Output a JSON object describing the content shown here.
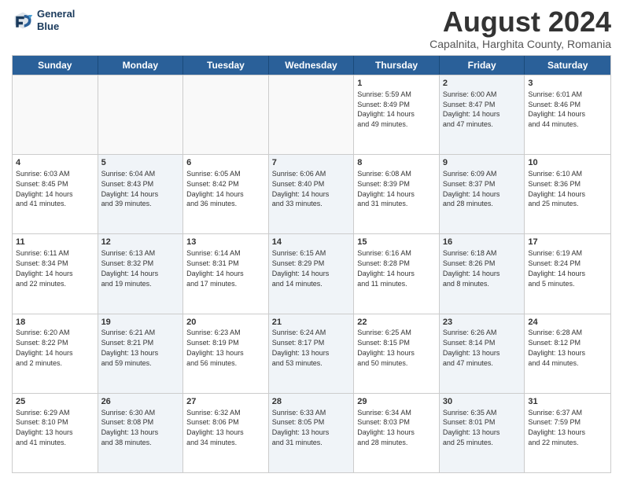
{
  "header": {
    "logo_line1": "General",
    "logo_line2": "Blue",
    "title": "August 2024",
    "subtitle": "Capalnita, Harghita County, Romania"
  },
  "days": [
    "Sunday",
    "Monday",
    "Tuesday",
    "Wednesday",
    "Thursday",
    "Friday",
    "Saturday"
  ],
  "rows": [
    [
      {
        "day": "",
        "text": "",
        "empty": true
      },
      {
        "day": "",
        "text": "",
        "empty": true
      },
      {
        "day": "",
        "text": "",
        "empty": true
      },
      {
        "day": "",
        "text": "",
        "empty": true
      },
      {
        "day": "1",
        "text": "Sunrise: 5:59 AM\nSunset: 8:49 PM\nDaylight: 14 hours\nand 49 minutes.",
        "shaded": false
      },
      {
        "day": "2",
        "text": "Sunrise: 6:00 AM\nSunset: 8:47 PM\nDaylight: 14 hours\nand 47 minutes.",
        "shaded": true
      },
      {
        "day": "3",
        "text": "Sunrise: 6:01 AM\nSunset: 8:46 PM\nDaylight: 14 hours\nand 44 minutes.",
        "shaded": false
      }
    ],
    [
      {
        "day": "4",
        "text": "Sunrise: 6:03 AM\nSunset: 8:45 PM\nDaylight: 14 hours\nand 41 minutes.",
        "shaded": false
      },
      {
        "day": "5",
        "text": "Sunrise: 6:04 AM\nSunset: 8:43 PM\nDaylight: 14 hours\nand 39 minutes.",
        "shaded": true
      },
      {
        "day": "6",
        "text": "Sunrise: 6:05 AM\nSunset: 8:42 PM\nDaylight: 14 hours\nand 36 minutes.",
        "shaded": false
      },
      {
        "day": "7",
        "text": "Sunrise: 6:06 AM\nSunset: 8:40 PM\nDaylight: 14 hours\nand 33 minutes.",
        "shaded": true
      },
      {
        "day": "8",
        "text": "Sunrise: 6:08 AM\nSunset: 8:39 PM\nDaylight: 14 hours\nand 31 minutes.",
        "shaded": false
      },
      {
        "day": "9",
        "text": "Sunrise: 6:09 AM\nSunset: 8:37 PM\nDaylight: 14 hours\nand 28 minutes.",
        "shaded": true
      },
      {
        "day": "10",
        "text": "Sunrise: 6:10 AM\nSunset: 8:36 PM\nDaylight: 14 hours\nand 25 minutes.",
        "shaded": false
      }
    ],
    [
      {
        "day": "11",
        "text": "Sunrise: 6:11 AM\nSunset: 8:34 PM\nDaylight: 14 hours\nand 22 minutes.",
        "shaded": false
      },
      {
        "day": "12",
        "text": "Sunrise: 6:13 AM\nSunset: 8:32 PM\nDaylight: 14 hours\nand 19 minutes.",
        "shaded": true
      },
      {
        "day": "13",
        "text": "Sunrise: 6:14 AM\nSunset: 8:31 PM\nDaylight: 14 hours\nand 17 minutes.",
        "shaded": false
      },
      {
        "day": "14",
        "text": "Sunrise: 6:15 AM\nSunset: 8:29 PM\nDaylight: 14 hours\nand 14 minutes.",
        "shaded": true
      },
      {
        "day": "15",
        "text": "Sunrise: 6:16 AM\nSunset: 8:28 PM\nDaylight: 14 hours\nand 11 minutes.",
        "shaded": false
      },
      {
        "day": "16",
        "text": "Sunrise: 6:18 AM\nSunset: 8:26 PM\nDaylight: 14 hours\nand 8 minutes.",
        "shaded": true
      },
      {
        "day": "17",
        "text": "Sunrise: 6:19 AM\nSunset: 8:24 PM\nDaylight: 14 hours\nand 5 minutes.",
        "shaded": false
      }
    ],
    [
      {
        "day": "18",
        "text": "Sunrise: 6:20 AM\nSunset: 8:22 PM\nDaylight: 14 hours\nand 2 minutes.",
        "shaded": false
      },
      {
        "day": "19",
        "text": "Sunrise: 6:21 AM\nSunset: 8:21 PM\nDaylight: 13 hours\nand 59 minutes.",
        "shaded": true
      },
      {
        "day": "20",
        "text": "Sunrise: 6:23 AM\nSunset: 8:19 PM\nDaylight: 13 hours\nand 56 minutes.",
        "shaded": false
      },
      {
        "day": "21",
        "text": "Sunrise: 6:24 AM\nSunset: 8:17 PM\nDaylight: 13 hours\nand 53 minutes.",
        "shaded": true
      },
      {
        "day": "22",
        "text": "Sunrise: 6:25 AM\nSunset: 8:15 PM\nDaylight: 13 hours\nand 50 minutes.",
        "shaded": false
      },
      {
        "day": "23",
        "text": "Sunrise: 6:26 AM\nSunset: 8:14 PM\nDaylight: 13 hours\nand 47 minutes.",
        "shaded": true
      },
      {
        "day": "24",
        "text": "Sunrise: 6:28 AM\nSunset: 8:12 PM\nDaylight: 13 hours\nand 44 minutes.",
        "shaded": false
      }
    ],
    [
      {
        "day": "25",
        "text": "Sunrise: 6:29 AM\nSunset: 8:10 PM\nDaylight: 13 hours\nand 41 minutes.",
        "shaded": false
      },
      {
        "day": "26",
        "text": "Sunrise: 6:30 AM\nSunset: 8:08 PM\nDaylight: 13 hours\nand 38 minutes.",
        "shaded": true
      },
      {
        "day": "27",
        "text": "Sunrise: 6:32 AM\nSunset: 8:06 PM\nDaylight: 13 hours\nand 34 minutes.",
        "shaded": false
      },
      {
        "day": "28",
        "text": "Sunrise: 6:33 AM\nSunset: 8:05 PM\nDaylight: 13 hours\nand 31 minutes.",
        "shaded": true
      },
      {
        "day": "29",
        "text": "Sunrise: 6:34 AM\nSunset: 8:03 PM\nDaylight: 13 hours\nand 28 minutes.",
        "shaded": false
      },
      {
        "day": "30",
        "text": "Sunrise: 6:35 AM\nSunset: 8:01 PM\nDaylight: 13 hours\nand 25 minutes.",
        "shaded": true
      },
      {
        "day": "31",
        "text": "Sunrise: 6:37 AM\nSunset: 7:59 PM\nDaylight: 13 hours\nand 22 minutes.",
        "shaded": false
      }
    ]
  ]
}
